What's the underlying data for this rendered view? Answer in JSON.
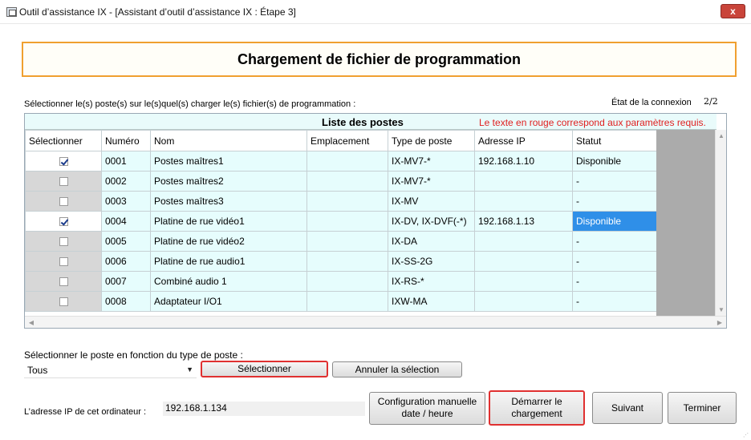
{
  "window": {
    "title": "Outil d’assistance IX - [Assistant d’outil d’assistance IX : Étape 3]",
    "close_label": "x"
  },
  "heading": "Chargement de fichier de programmation",
  "instruction": "Sélectionner le(s) poste(s) sur le(s)quel(s) charger le(s) fichier(s) de programmation :",
  "connection": {
    "label": "État de la connexion",
    "value": "2/2"
  },
  "table": {
    "title": "Liste des postes",
    "required_note": "Le texte en rouge correspond aux paramètres requis.",
    "columns": [
      "Sélectionner",
      "Numéro",
      "Nom",
      "Emplacement",
      "Type de poste",
      "Adresse IP",
      "Statut"
    ],
    "rows": [
      {
        "checked": true,
        "number": "0001",
        "name": "Postes maîtres1",
        "location": "",
        "type": "IX-MV7-*",
        "ip": "192.168.1.10",
        "status": "Disponible",
        "status_highlight": false
      },
      {
        "checked": false,
        "number": "0002",
        "name": "Postes maîtres2",
        "location": "",
        "type": "IX-MV7-*",
        "ip": "",
        "status": "-",
        "status_highlight": false
      },
      {
        "checked": false,
        "number": "0003",
        "name": "Postes maîtres3",
        "location": "",
        "type": "IX-MV",
        "ip": "",
        "status": "-",
        "status_highlight": false
      },
      {
        "checked": true,
        "number": "0004",
        "name": "Platine de rue vidéo1",
        "location": "",
        "type": "IX-DV, IX-DVF(-*)",
        "ip": "192.168.1.13",
        "status": "Disponible",
        "status_highlight": true
      },
      {
        "checked": false,
        "number": "0005",
        "name": "Platine de rue vidéo2",
        "location": "",
        "type": "IX-DA",
        "ip": "",
        "status": "-",
        "status_highlight": false
      },
      {
        "checked": false,
        "number": "0006",
        "name": "Platine de rue audio1",
        "location": "",
        "type": "IX-SS-2G",
        "ip": "",
        "status": "-",
        "status_highlight": false
      },
      {
        "checked": false,
        "number": "0007",
        "name": "Combiné audio 1",
        "location": "",
        "type": "IX-RS-*",
        "ip": "",
        "status": "-",
        "status_highlight": false
      },
      {
        "checked": false,
        "number": "0008",
        "name": "Adaptateur I/O1",
        "location": "",
        "type": "IXW-MA",
        "ip": "",
        "status": "-",
        "status_highlight": false
      }
    ]
  },
  "filter": {
    "label": "Sélectionner le poste en fonction du type de poste :",
    "selected": "Tous",
    "select_button": "Sélectionner",
    "cancel_button": "Annuler la sélection"
  },
  "ip_info": {
    "label": "L’adresse IP de cet ordinateur :",
    "value": "192.168.1.134"
  },
  "buttons": {
    "config_line1": "Configuration manuelle",
    "config_line2": "date / heure",
    "start_line1": "Démarrer le",
    "start_line2": "chargement",
    "next": "Suivant",
    "finish": "Terminer"
  }
}
